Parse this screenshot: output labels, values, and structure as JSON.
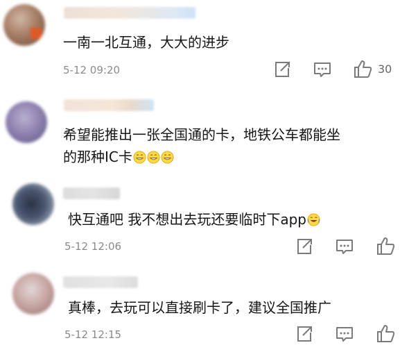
{
  "comments": [
    {
      "text": "一南一北互通，大大的进步",
      "time": "5-12 09:20",
      "likes": "30",
      "emoji_count": 0
    },
    {
      "text_line1": "希望能推出一张全国通的卡，地铁公车都能坐",
      "text_line2": "的那种IC卡",
      "emoji_count": 3
    },
    {
      "text": "快互通吧 我不想出去玩还要临时下app",
      "time": "5-12 12:06",
      "emoji_count": 1
    },
    {
      "text": "真棒，去玩可以直接刷卡了，建议全国推广",
      "time": "5-12 12:15",
      "emoji_count": 0
    }
  ],
  "icons": {
    "share": "share-icon",
    "reply": "comment-icon",
    "like": "like-icon"
  },
  "colors": {
    "text": "#151515",
    "meta": "#8a8a8a",
    "icon": "#7a7a7a"
  }
}
